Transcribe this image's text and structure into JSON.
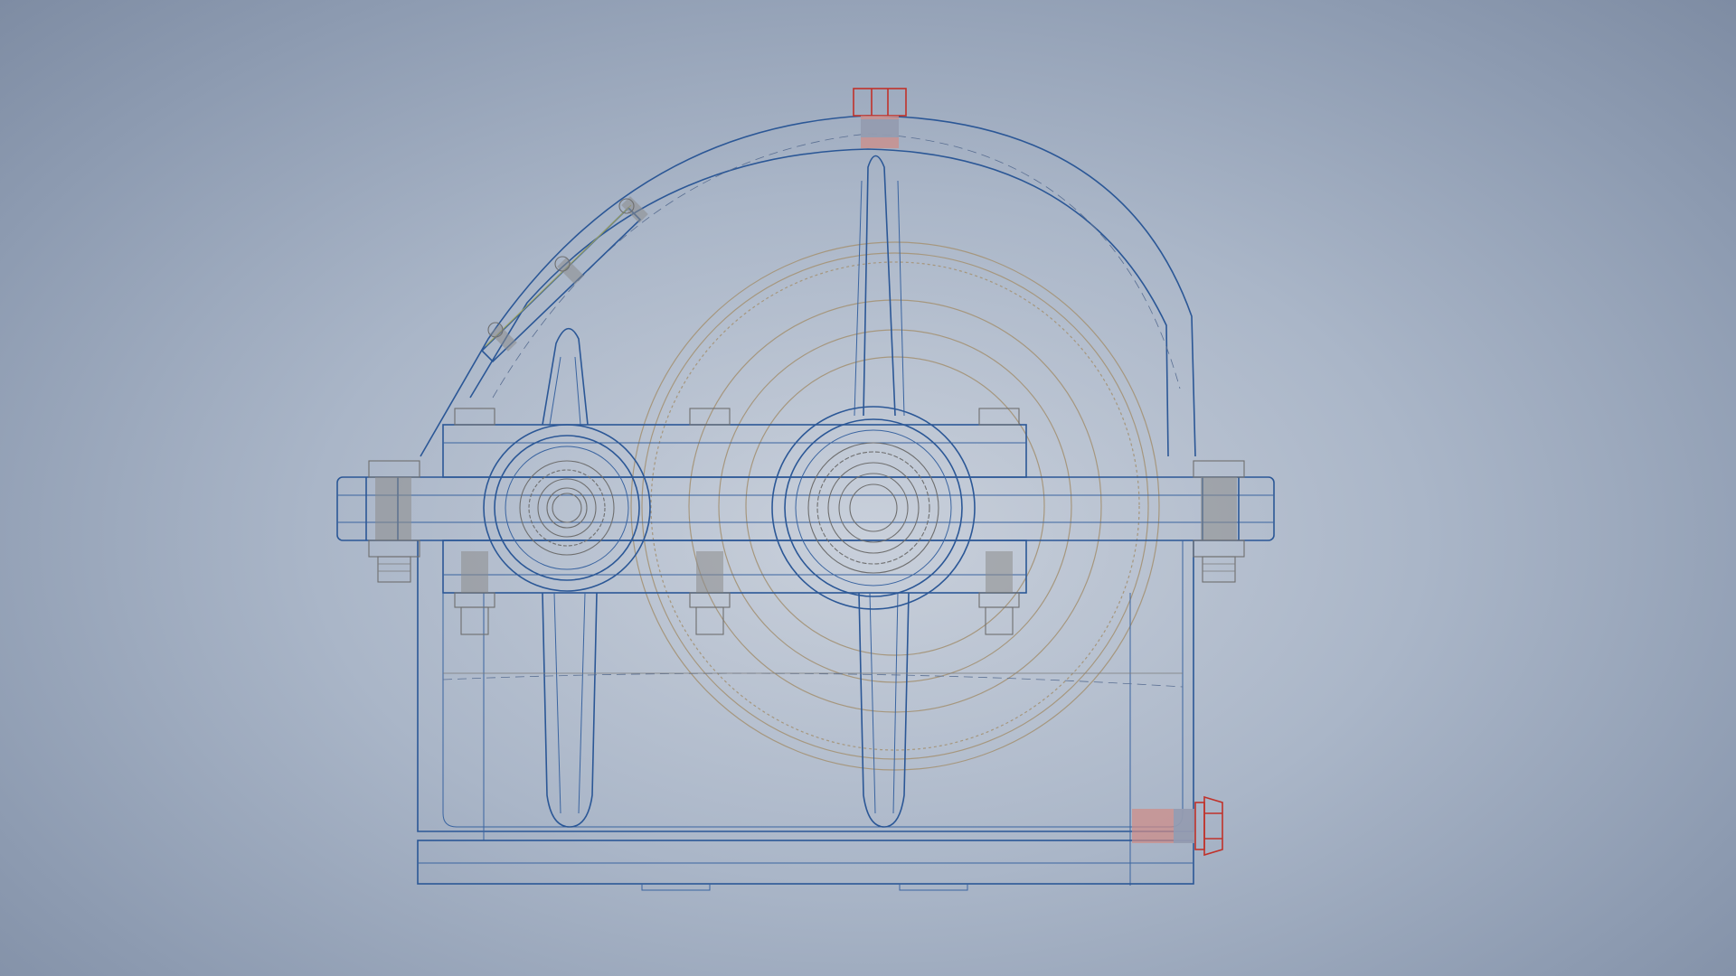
{
  "viewport": {
    "background_top": "#8d9bb1",
    "background_center": "#c9d0db",
    "line_color": "#2b5796",
    "highlight_color": "#c0322a",
    "component_color": "#6e6e6e"
  },
  "model": {
    "view": "front-wireframe",
    "components": [
      "gearbox-housing",
      "housing-cover",
      "inspection-cover",
      "breather-plug",
      "drain-plug",
      "input-shaft-bearing",
      "output-shaft-bearing",
      "large-gear",
      "flange-bolts"
    ]
  }
}
